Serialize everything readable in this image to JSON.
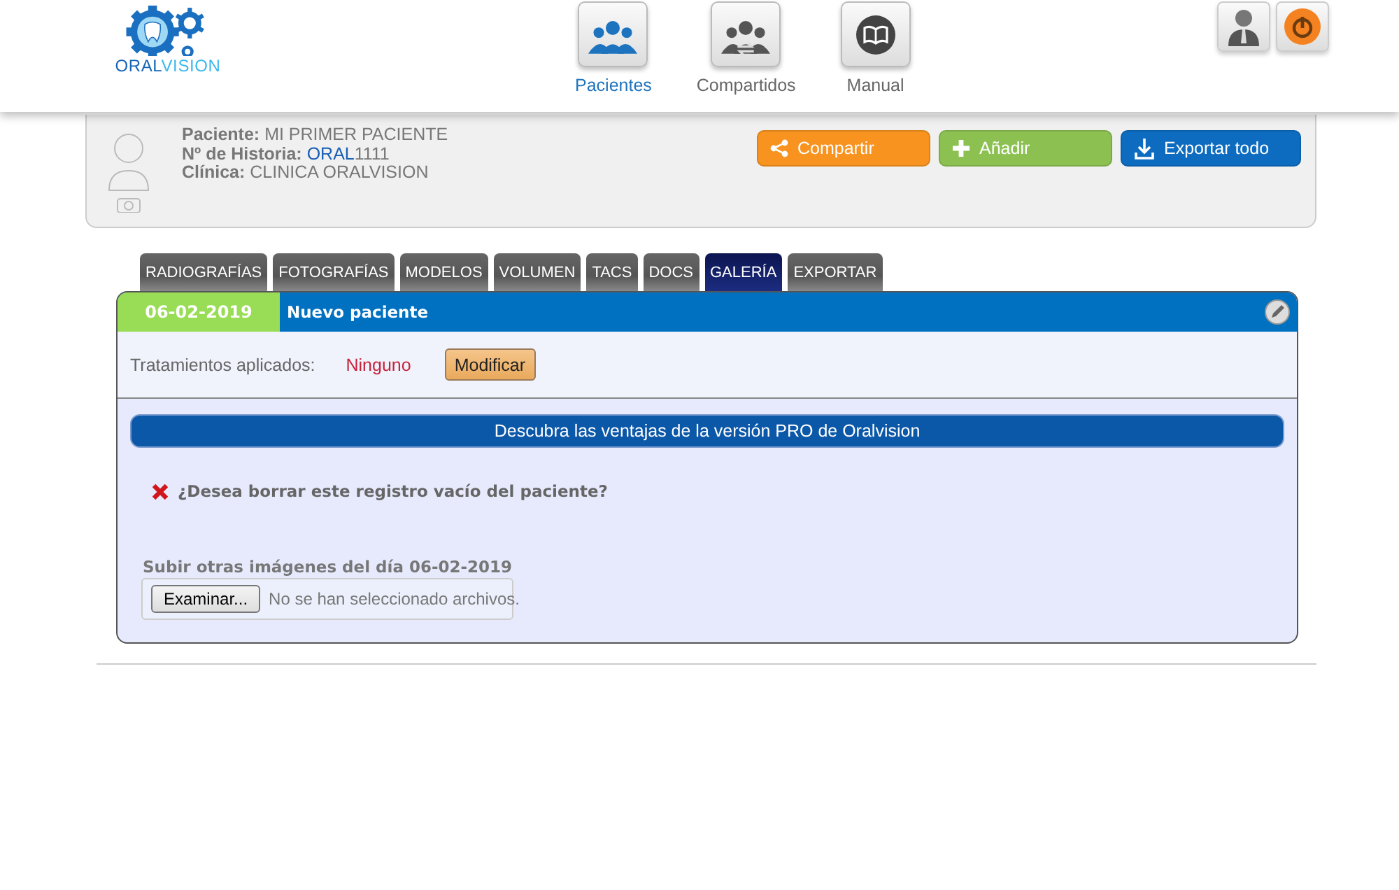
{
  "brand": {
    "part_1": "ORAL",
    "part_2": "VISION"
  },
  "nav": [
    {
      "label": "Pacientes",
      "kind": "patients",
      "selected": true
    },
    {
      "label": "Compartidos",
      "kind": "shared",
      "selected": false
    },
    {
      "label": "Manual",
      "kind": "manual",
      "selected": false
    }
  ],
  "patient": {
    "fields": [
      {
        "label": "Paciente:",
        "value": "MI PRIMER PACIENTE",
        "kind": "plain"
      },
      {
        "label": "Nº de Historia:",
        "prefix": "ORAL",
        "value": "1111",
        "kind": "history"
      },
      {
        "label": "Clínica:",
        "value": "CLINICA ORALVISION",
        "kind": "plain"
      }
    ],
    "actions": [
      {
        "label": "Compartir",
        "kind": "share"
      },
      {
        "label": "Añadir",
        "kind": "add"
      },
      {
        "label": "Exportar todo",
        "kind": "export"
      }
    ]
  },
  "tabs": [
    {
      "label": "RADIOGRAFÍAS",
      "selected": false
    },
    {
      "label": "FOTOGRAFÍAS",
      "selected": false
    },
    {
      "label": "MODELOS",
      "selected": false
    },
    {
      "label": "VOLUMEN",
      "selected": false
    },
    {
      "label": "TACS",
      "selected": false
    },
    {
      "label": "DOCS",
      "selected": false
    },
    {
      "label": "GALERÍA",
      "selected": true
    },
    {
      "label": "EXPORTAR",
      "selected": false
    }
  ],
  "record": {
    "date": "06-02-2019",
    "title": "Nuevo paciente",
    "treatments_label": "Tratamientos aplicados:",
    "treatments_value": "Ninguno",
    "modify_button": "Modificar",
    "promo": "Descubra las ventajas de la versión PRO de Oralvision",
    "delete_question": "¿Desea borrar este registro vacío del paciente?",
    "upload_label": "Subir otras imágenes del día 06-02-2019",
    "browse_button": "Examinar...",
    "file_status": "No se han seleccionado archivos."
  }
}
